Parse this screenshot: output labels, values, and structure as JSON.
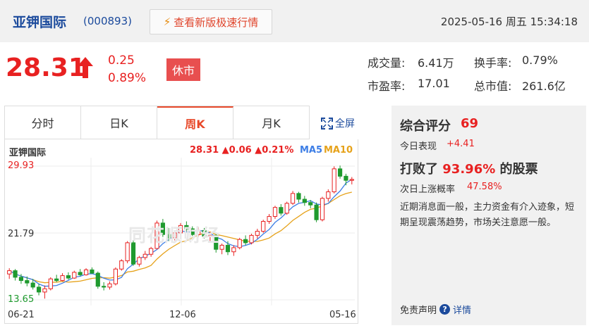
{
  "header": {
    "stock_name": "亚钾国际",
    "stock_code": "(000893)",
    "fast_version_label": "查看新版极速行情",
    "datetime": "2025-05-16 周五 15:34:18"
  },
  "quote": {
    "price": "28.31",
    "change": "0.25",
    "change_pct": "0.89%",
    "status": "休市",
    "stats": {
      "volume_label": "成交量:",
      "volume": "6.41万",
      "turnover_label": "换手率:",
      "turnover": "0.79%",
      "pe_label": "市盈率:",
      "pe": "17.01",
      "mcap_label": "总市值:",
      "mcap": "261.6亿"
    }
  },
  "tabs": [
    {
      "label": "分时",
      "active": false
    },
    {
      "label": "日K",
      "active": false
    },
    {
      "label": "周K",
      "active": true
    },
    {
      "label": "月K",
      "active": false
    }
  ],
  "fullscreen_label": "全屏",
  "chart": {
    "title": "亚钾国际",
    "quote_text": "28.31 ▲0.06 ▲0.21%",
    "ma5_label": "MA5",
    "ma10_label": "MA10",
    "y_top": "29.93",
    "y_mid": "21.79",
    "y_bottom": "13.65",
    "x_start": "06-21",
    "x_mid": "12-06",
    "x_end": "05-16",
    "watermark": "同花顺财经"
  },
  "chart_data": {
    "type": "candlestick",
    "title": "亚钾国际",
    "ylim": [
      13.65,
      29.93
    ],
    "y_ticks": [
      "29.93",
      "21.79",
      "13.65"
    ],
    "x_ticks": [
      "06-21",
      "12-06",
      "05-16"
    ],
    "series": [
      {
        "name": "MA5"
      },
      {
        "name": "MA10"
      }
    ],
    "candles": [
      [
        16.8,
        17.5,
        16.2,
        17.2
      ],
      [
        17.2,
        17.4,
        16.0,
        16.4
      ],
      [
        16.4,
        16.8,
        15.6,
        16.0
      ],
      [
        16.0,
        16.5,
        15.3,
        15.7
      ],
      [
        15.7,
        16.2,
        14.9,
        15.2
      ],
      [
        15.2,
        15.6,
        14.2,
        14.6
      ],
      [
        14.6,
        15.4,
        13.8,
        15.0
      ],
      [
        15.0,
        16.4,
        14.8,
        16.2
      ],
      [
        16.2,
        16.7,
        15.8,
        16.0
      ],
      [
        16.0,
        16.9,
        15.9,
        16.6
      ],
      [
        16.6,
        17.0,
        16.1,
        16.3
      ],
      [
        16.3,
        17.2,
        16.2,
        17.0
      ],
      [
        17.0,
        17.4,
        16.5,
        16.7
      ],
      [
        16.7,
        17.5,
        16.6,
        17.3
      ],
      [
        17.3,
        17.6,
        16.8,
        16.9
      ],
      [
        16.9,
        17.1,
        15.0,
        15.3
      ],
      [
        15.3,
        15.8,
        14.8,
        15.2
      ],
      [
        15.2,
        15.9,
        14.9,
        15.6
      ],
      [
        15.6,
        17.6,
        15.4,
        17.4
      ],
      [
        17.4,
        18.6,
        17.2,
        18.4
      ],
      [
        18.4,
        20.8,
        18.1,
        20.6
      ],
      [
        20.6,
        20.9,
        17.8,
        18.0
      ],
      [
        18.0,
        19.0,
        17.7,
        18.8
      ],
      [
        18.8,
        19.6,
        18.5,
        19.2
      ],
      [
        19.2,
        20.1,
        18.9,
        19.9
      ],
      [
        19.9,
        23.3,
        19.8,
        23.0
      ],
      [
        23.0,
        23.5,
        21.3,
        21.6
      ],
      [
        21.6,
        22.4,
        20.8,
        21.2
      ],
      [
        21.2,
        22.1,
        20.9,
        21.8
      ],
      [
        21.8,
        23.0,
        21.5,
        22.7
      ],
      [
        22.7,
        23.2,
        22.0,
        22.3
      ],
      [
        22.3,
        22.6,
        21.4,
        21.6
      ],
      [
        21.6,
        22.5,
        21.3,
        22.1
      ],
      [
        22.1,
        22.4,
        21.1,
        21.4
      ],
      [
        21.4,
        21.9,
        20.8,
        21.5
      ],
      [
        21.5,
        21.8,
        19.4,
        19.8
      ],
      [
        19.8,
        20.5,
        19.2,
        20.3
      ],
      [
        20.3,
        20.8,
        19.1,
        19.5
      ],
      [
        19.5,
        20.3,
        19.0,
        20.0
      ],
      [
        20.0,
        21.2,
        19.8,
        21.0
      ],
      [
        21.0,
        21.5,
        20.3,
        20.6
      ],
      [
        20.6,
        21.7,
        20.4,
        21.5
      ],
      [
        21.5,
        22.3,
        21.1,
        22.0
      ],
      [
        22.0,
        23.4,
        21.8,
        23.2
      ],
      [
        23.2,
        24.1,
        22.9,
        23.8
      ],
      [
        23.8,
        25.1,
        23.5,
        24.9
      ],
      [
        24.9,
        25.3,
        23.9,
        24.2
      ],
      [
        24.2,
        25.6,
        24.0,
        25.4
      ],
      [
        25.4,
        26.9,
        25.2,
        26.6
      ],
      [
        26.6,
        26.8,
        25.5,
        25.9
      ],
      [
        25.9,
        26.3,
        25.1,
        25.5
      ],
      [
        25.5,
        25.8,
        24.8,
        25.2
      ],
      [
        25.2,
        25.5,
        23.1,
        23.4
      ],
      [
        23.4,
        26.2,
        23.2,
        26.0
      ],
      [
        26.0,
        27.1,
        25.6,
        26.8
      ],
      [
        26.8,
        29.9,
        26.6,
        29.6
      ],
      [
        29.6,
        30.0,
        28.4,
        28.7
      ],
      [
        28.7,
        29.0,
        27.6,
        28.2
      ],
      [
        28.2,
        28.6,
        27.7,
        28.31
      ]
    ]
  },
  "rating": {
    "title": "综合评分",
    "score": "69",
    "today_label": "今日表现",
    "today_value": "+4.41",
    "beat_prefix": "打败了",
    "beat_pct": "93.96%",
    "beat_suffix": "的股票",
    "next_label": "次日上涨概率",
    "next_value": "47.58%",
    "comment": "近期消息面一般，主力资金有介入迹象，短期呈现震荡趋势，市场关注意愿一般。",
    "disclaimer_label": "免责声明",
    "detail_label": "详情"
  },
  "colors": {
    "up": "#e82121",
    "down": "#1f9a2e",
    "ma5": "#3d7ee6",
    "ma10": "#e6a21a",
    "accent": "#e8492a"
  }
}
